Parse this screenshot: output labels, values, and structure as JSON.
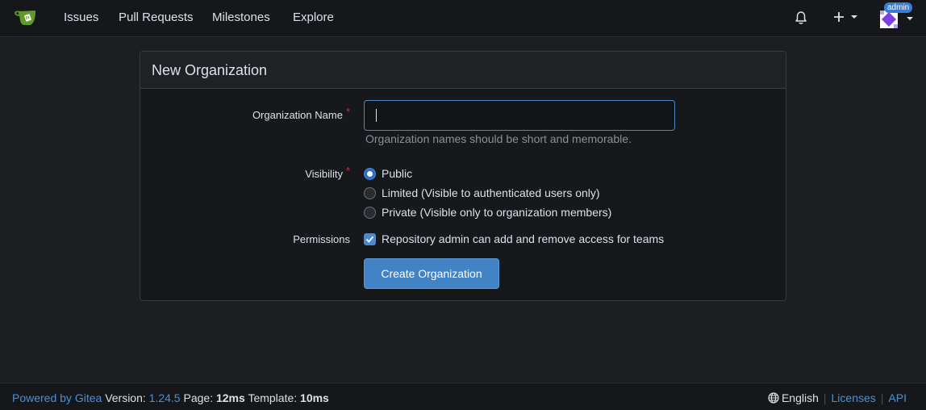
{
  "nav": {
    "links": [
      "Issues",
      "Pull Requests",
      "Milestones",
      "Explore"
    ],
    "admin_badge": "admin",
    "icons": [
      "gitea-logo-icon",
      "bell-icon",
      "plus-icon",
      "avatar"
    ]
  },
  "form": {
    "title": "New Organization",
    "org_name_label": "Organization Name",
    "org_name_value": "",
    "org_name_help": "Organization names should be short and memorable.",
    "visibility_label": "Visibility",
    "visibility_options": [
      {
        "label": "Public",
        "checked": true
      },
      {
        "label": "Limited (Visible to authenticated users only)",
        "checked": false
      },
      {
        "label": "Private (Visible only to organization members)",
        "checked": false
      }
    ],
    "permissions_label": "Permissions",
    "permissions_option": "Repository admin can add and remove access for teams",
    "permissions_checked": true,
    "submit_label": "Create Organization",
    "required_mark": "*"
  },
  "footer": {
    "powered_by": "Powered by Gitea",
    "version_label": "Version:",
    "version": "1.24.5",
    "page_label": "Page:",
    "page_time": "12ms",
    "template_label": "Template:",
    "template_time": "10ms",
    "language": "English",
    "licenses": "Licenses",
    "api": "API"
  },
  "colors": {
    "accent": "#4183c4",
    "background": "#1c1e22",
    "required": "#db2828"
  }
}
